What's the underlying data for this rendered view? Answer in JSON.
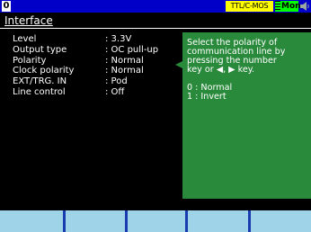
{
  "status_bar": {
    "port_number": "0",
    "signal_level": "TTL/C-MOS",
    "mode": "Mon",
    "icons": [
      "grip-icon",
      "speaker-icon"
    ]
  },
  "menu": {
    "title": "Interface"
  },
  "settings": [
    {
      "label": "Level",
      "value": ": 3.3V"
    },
    {
      "label": "Output type",
      "value": ": OC pull-up"
    },
    {
      "label": "Polarity",
      "value": ": Normal"
    },
    {
      "label": "Clock polarity",
      "value": ": Normal"
    },
    {
      "label": "EXT/TRG. IN",
      "value": ": Pod"
    },
    {
      "label": "Line control",
      "value": ": Off"
    }
  ],
  "help": {
    "lines": [
      "Select the polarity of",
      "communication line by",
      "pressing the number",
      "key or ◀, ▶ key."
    ],
    "options": [
      "0 : Normal",
      "1 : Invert"
    ]
  },
  "function_keys": [
    "",
    "",
    "",
    "",
    "",
    ""
  ],
  "colors": {
    "top_bar": "#0000c8",
    "help_panel": "#2a8a3c",
    "ttl_badge": "#ffff00",
    "mon_badge": "#00ff00",
    "function_key": "#9fd3e8",
    "function_key_divider": "#1a3ab0"
  }
}
